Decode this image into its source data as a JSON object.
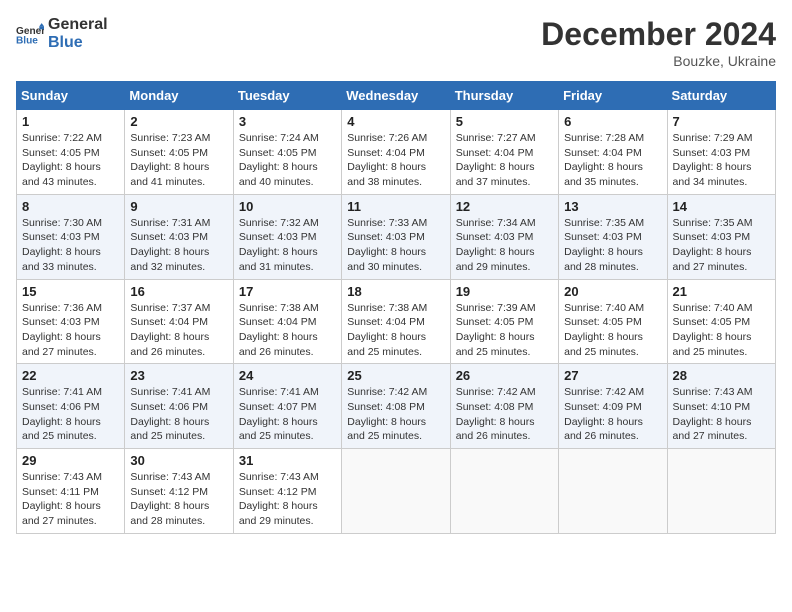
{
  "header": {
    "logo_general": "General",
    "logo_blue": "Blue",
    "month": "December 2024",
    "location": "Bouzke, Ukraine"
  },
  "weekdays": [
    "Sunday",
    "Monday",
    "Tuesday",
    "Wednesday",
    "Thursday",
    "Friday",
    "Saturday"
  ],
  "weeks": [
    [
      {
        "day": "1",
        "sunrise": "Sunrise: 7:22 AM",
        "sunset": "Sunset: 4:05 PM",
        "daylight": "Daylight: 8 hours and 43 minutes."
      },
      {
        "day": "2",
        "sunrise": "Sunrise: 7:23 AM",
        "sunset": "Sunset: 4:05 PM",
        "daylight": "Daylight: 8 hours and 41 minutes."
      },
      {
        "day": "3",
        "sunrise": "Sunrise: 7:24 AM",
        "sunset": "Sunset: 4:05 PM",
        "daylight": "Daylight: 8 hours and 40 minutes."
      },
      {
        "day": "4",
        "sunrise": "Sunrise: 7:26 AM",
        "sunset": "Sunset: 4:04 PM",
        "daylight": "Daylight: 8 hours and 38 minutes."
      },
      {
        "day": "5",
        "sunrise": "Sunrise: 7:27 AM",
        "sunset": "Sunset: 4:04 PM",
        "daylight": "Daylight: 8 hours and 37 minutes."
      },
      {
        "day": "6",
        "sunrise": "Sunrise: 7:28 AM",
        "sunset": "Sunset: 4:04 PM",
        "daylight": "Daylight: 8 hours and 35 minutes."
      },
      {
        "day": "7",
        "sunrise": "Sunrise: 7:29 AM",
        "sunset": "Sunset: 4:03 PM",
        "daylight": "Daylight: 8 hours and 34 minutes."
      }
    ],
    [
      {
        "day": "8",
        "sunrise": "Sunrise: 7:30 AM",
        "sunset": "Sunset: 4:03 PM",
        "daylight": "Daylight: 8 hours and 33 minutes."
      },
      {
        "day": "9",
        "sunrise": "Sunrise: 7:31 AM",
        "sunset": "Sunset: 4:03 PM",
        "daylight": "Daylight: 8 hours and 32 minutes."
      },
      {
        "day": "10",
        "sunrise": "Sunrise: 7:32 AM",
        "sunset": "Sunset: 4:03 PM",
        "daylight": "Daylight: 8 hours and 31 minutes."
      },
      {
        "day": "11",
        "sunrise": "Sunrise: 7:33 AM",
        "sunset": "Sunset: 4:03 PM",
        "daylight": "Daylight: 8 hours and 30 minutes."
      },
      {
        "day": "12",
        "sunrise": "Sunrise: 7:34 AM",
        "sunset": "Sunset: 4:03 PM",
        "daylight": "Daylight: 8 hours and 29 minutes."
      },
      {
        "day": "13",
        "sunrise": "Sunrise: 7:35 AM",
        "sunset": "Sunset: 4:03 PM",
        "daylight": "Daylight: 8 hours and 28 minutes."
      },
      {
        "day": "14",
        "sunrise": "Sunrise: 7:35 AM",
        "sunset": "Sunset: 4:03 PM",
        "daylight": "Daylight: 8 hours and 27 minutes."
      }
    ],
    [
      {
        "day": "15",
        "sunrise": "Sunrise: 7:36 AM",
        "sunset": "Sunset: 4:03 PM",
        "daylight": "Daylight: 8 hours and 27 minutes."
      },
      {
        "day": "16",
        "sunrise": "Sunrise: 7:37 AM",
        "sunset": "Sunset: 4:04 PM",
        "daylight": "Daylight: 8 hours and 26 minutes."
      },
      {
        "day": "17",
        "sunrise": "Sunrise: 7:38 AM",
        "sunset": "Sunset: 4:04 PM",
        "daylight": "Daylight: 8 hours and 26 minutes."
      },
      {
        "day": "18",
        "sunrise": "Sunrise: 7:38 AM",
        "sunset": "Sunset: 4:04 PM",
        "daylight": "Daylight: 8 hours and 25 minutes."
      },
      {
        "day": "19",
        "sunrise": "Sunrise: 7:39 AM",
        "sunset": "Sunset: 4:05 PM",
        "daylight": "Daylight: 8 hours and 25 minutes."
      },
      {
        "day": "20",
        "sunrise": "Sunrise: 7:40 AM",
        "sunset": "Sunset: 4:05 PM",
        "daylight": "Daylight: 8 hours and 25 minutes."
      },
      {
        "day": "21",
        "sunrise": "Sunrise: 7:40 AM",
        "sunset": "Sunset: 4:05 PM",
        "daylight": "Daylight: 8 hours and 25 minutes."
      }
    ],
    [
      {
        "day": "22",
        "sunrise": "Sunrise: 7:41 AM",
        "sunset": "Sunset: 4:06 PM",
        "daylight": "Daylight: 8 hours and 25 minutes."
      },
      {
        "day": "23",
        "sunrise": "Sunrise: 7:41 AM",
        "sunset": "Sunset: 4:06 PM",
        "daylight": "Daylight: 8 hours and 25 minutes."
      },
      {
        "day": "24",
        "sunrise": "Sunrise: 7:41 AM",
        "sunset": "Sunset: 4:07 PM",
        "daylight": "Daylight: 8 hours and 25 minutes."
      },
      {
        "day": "25",
        "sunrise": "Sunrise: 7:42 AM",
        "sunset": "Sunset: 4:08 PM",
        "daylight": "Daylight: 8 hours and 25 minutes."
      },
      {
        "day": "26",
        "sunrise": "Sunrise: 7:42 AM",
        "sunset": "Sunset: 4:08 PM",
        "daylight": "Daylight: 8 hours and 26 minutes."
      },
      {
        "day": "27",
        "sunrise": "Sunrise: 7:42 AM",
        "sunset": "Sunset: 4:09 PM",
        "daylight": "Daylight: 8 hours and 26 minutes."
      },
      {
        "day": "28",
        "sunrise": "Sunrise: 7:43 AM",
        "sunset": "Sunset: 4:10 PM",
        "daylight": "Daylight: 8 hours and 27 minutes."
      }
    ],
    [
      {
        "day": "29",
        "sunrise": "Sunrise: 7:43 AM",
        "sunset": "Sunset: 4:11 PM",
        "daylight": "Daylight: 8 hours and 27 minutes."
      },
      {
        "day": "30",
        "sunrise": "Sunrise: 7:43 AM",
        "sunset": "Sunset: 4:12 PM",
        "daylight": "Daylight: 8 hours and 28 minutes."
      },
      {
        "day": "31",
        "sunrise": "Sunrise: 7:43 AM",
        "sunset": "Sunset: 4:12 PM",
        "daylight": "Daylight: 8 hours and 29 minutes."
      },
      null,
      null,
      null,
      null
    ]
  ]
}
